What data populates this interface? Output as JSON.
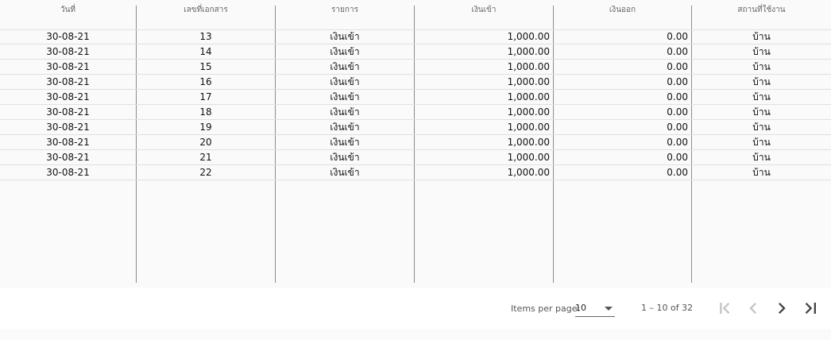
{
  "table": {
    "headers": [
      "วันที่",
      "เลขที่เอกสาร",
      "รายการ",
      "เงินเข้า",
      "เงินออก",
      "สถานที่ใช้งาน"
    ],
    "rows": [
      [
        "30-08-21",
        "13",
        "เงินเข้า",
        "1,000.00",
        "0.00",
        "บ้าน"
      ],
      [
        "30-08-21",
        "14",
        "เงินเข้า",
        "1,000.00",
        "0.00",
        "บ้าน"
      ],
      [
        "30-08-21",
        "15",
        "เงินเข้า",
        "1,000.00",
        "0.00",
        "บ้าน"
      ],
      [
        "30-08-21",
        "16",
        "เงินเข้า",
        "1,000.00",
        "0.00",
        "บ้าน"
      ],
      [
        "30-08-21",
        "17",
        "เงินเข้า",
        "1,000.00",
        "0.00",
        "บ้าน"
      ],
      [
        "30-08-21",
        "18",
        "เงินเข้า",
        "1,000.00",
        "0.00",
        "บ้าน"
      ],
      [
        "30-08-21",
        "19",
        "เงินเข้า",
        "1,000.00",
        "0.00",
        "บ้าน"
      ],
      [
        "30-08-21",
        "20",
        "เงินเข้า",
        "1,000.00",
        "0.00",
        "บ้าน"
      ],
      [
        "30-08-21",
        "21",
        "เงินเข้า",
        "1,000.00",
        "0.00",
        "บ้าน"
      ],
      [
        "30-08-21",
        "22",
        "เงินเข้า",
        "1,000.00",
        "0.00",
        "บ้าน"
      ]
    ]
  },
  "paginator": {
    "items_per_page_label": "Items per page:",
    "page_size": "10",
    "range_label": "1 – 10 of 32",
    "icons": {
      "first": "first-page-icon",
      "prev": "chevron-left-icon",
      "next": "chevron-right-icon",
      "last": "last-page-icon"
    },
    "colors": {
      "enabled": "#444444",
      "disabled": "#c4c4c4"
    }
  }
}
